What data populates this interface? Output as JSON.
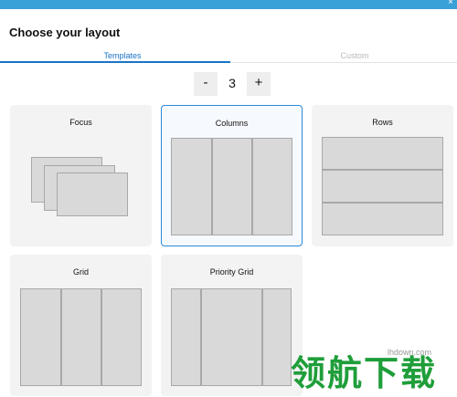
{
  "window": {
    "close_glyph": "×"
  },
  "header": {
    "title": "Choose your layout"
  },
  "tabs": [
    {
      "label": "Templates",
      "active": true
    },
    {
      "label": "Custom",
      "active": false
    }
  ],
  "stepper": {
    "minus_label": "-",
    "value": "3",
    "plus_label": "+"
  },
  "layouts": [
    {
      "label": "Focus",
      "selected": false
    },
    {
      "label": "Columns",
      "selected": true
    },
    {
      "label": "Rows",
      "selected": false
    },
    {
      "label": "Grid",
      "selected": false
    },
    {
      "label": "Priority Grid",
      "selected": false
    }
  ],
  "watermark": {
    "text": "领航下载",
    "url": "lhdown.com"
  },
  "colors": {
    "accent": "#1a73c8",
    "titlebar": "#3aa0d8",
    "pane": "#d9d9d9",
    "card": "#f3f3f3"
  }
}
